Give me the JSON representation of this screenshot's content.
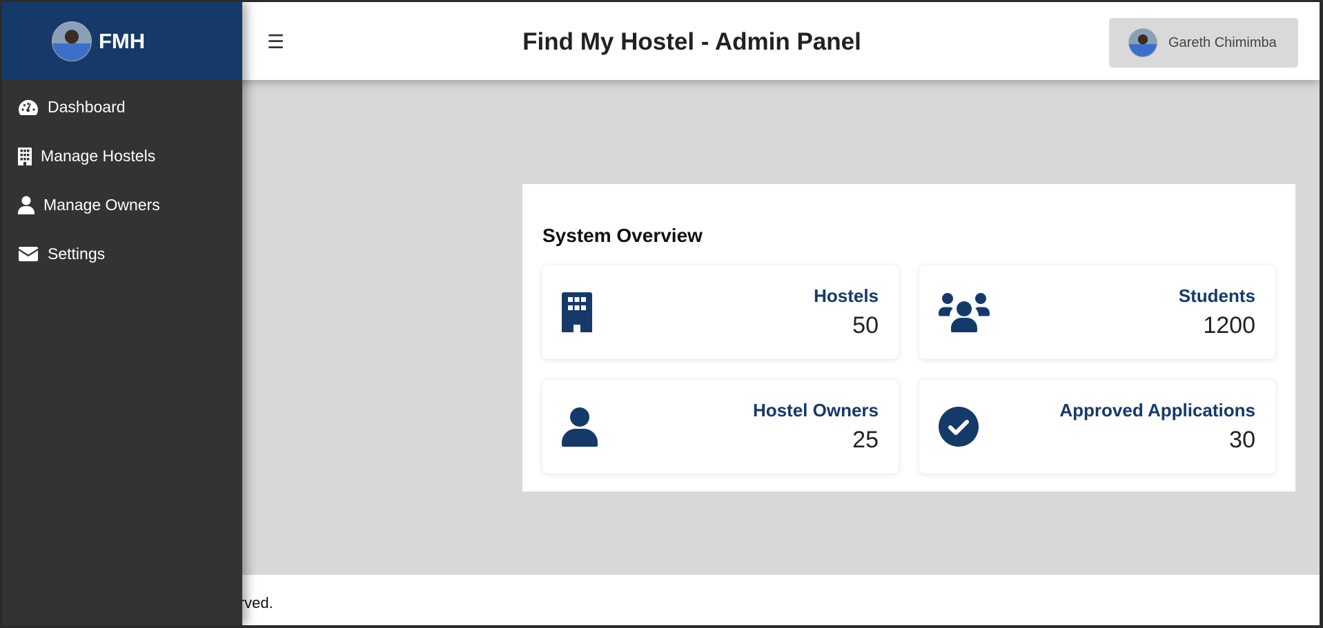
{
  "brand": {
    "name": "FMH"
  },
  "header": {
    "menu_icon": "hamburger-icon",
    "title": "Find My Hostel - Admin Panel",
    "user_name": "Gareth Chimimba"
  },
  "sidebar": {
    "items": [
      {
        "label": "Dashboard",
        "icon": "gauge-icon"
      },
      {
        "label": "Manage Hostels",
        "icon": "building-icon"
      },
      {
        "label": "Manage Owners",
        "icon": "user-icon"
      },
      {
        "label": "Settings",
        "icon": "envelope-icon"
      }
    ]
  },
  "overview": {
    "title": "System Overview",
    "stats": [
      {
        "label": "Hostels",
        "value": "50",
        "icon": "building-icon"
      },
      {
        "label": "Students",
        "value": "1200",
        "icon": "users-icon"
      },
      {
        "label": "Hostel Owners",
        "value": "25",
        "icon": "user-icon"
      },
      {
        "label": "Approved Applications",
        "value": "30",
        "icon": "check-circle-icon"
      }
    ]
  },
  "footer": {
    "text": "reserved."
  },
  "colors": {
    "primary": "#153a6a",
    "sidebar": "#333333",
    "background": "#d8d8d8"
  }
}
